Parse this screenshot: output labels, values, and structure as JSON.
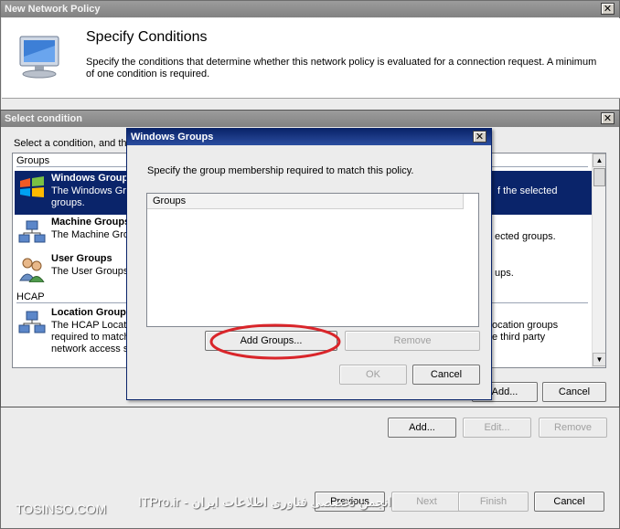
{
  "main_window": {
    "title": "New Network Policy",
    "heading": "Specify Conditions",
    "description_line1": "Specify the conditions that determine whether this network policy is evaluated for a connection request. A minimum",
    "description_line2": "of one condition is required.",
    "buttons": {
      "add": "Add...",
      "edit": "Edit...",
      "remove": "Remove",
      "previous": "Previous",
      "next": "Next",
      "finish": "Finish",
      "cancel": "Cancel"
    }
  },
  "select_condition": {
    "title": "Select condition",
    "instruction": "Select a condition, and then",
    "groups": [
      {
        "label": "Groups",
        "items": [
          {
            "title": "Windows Groups",
            "desc1": "The Windows Gro",
            "desc1_right": "f the selected",
            "desc2": "groups.",
            "selected": true,
            "icon": "windows-groups-icon"
          },
          {
            "title": "Machine Groups",
            "desc1": "The Machine Gro",
            "desc1_right": "ected groups.",
            "selected": false,
            "icon": "machine-groups-icon"
          },
          {
            "title": "User Groups",
            "desc1": "The User Groups",
            "desc1_right": "ups.",
            "selected": false,
            "icon": "user-groups-icon"
          }
        ]
      },
      {
        "label": "HCAP",
        "items": [
          {
            "title": "Location Groups",
            "desc1": "The HCAP Locat",
            "desc1_right": "ocation groups",
            "desc2": "required to match",
            "desc2_right": "e third party",
            "desc3": "network access s",
            "selected": false,
            "icon": "location-groups-icon"
          }
        ]
      }
    ],
    "buttons": {
      "add": "Add...",
      "cancel": "Cancel"
    }
  },
  "windows_groups": {
    "title": "Windows Groups",
    "instruction": "Specify the group membership required to match this policy.",
    "list_header": "Groups",
    "buttons": {
      "add_groups": "Add Groups...",
      "remove": "Remove",
      "ok": "OK",
      "cancel": "Cancel"
    }
  },
  "watermarks": {
    "left": "TOSINSO.COM",
    "right": "انجمن تخصصی فناوری اطلاعات ایران - ITPro.ir"
  },
  "colors": {
    "selection": "#0a246a",
    "highlight_circle": "#d9252a"
  }
}
